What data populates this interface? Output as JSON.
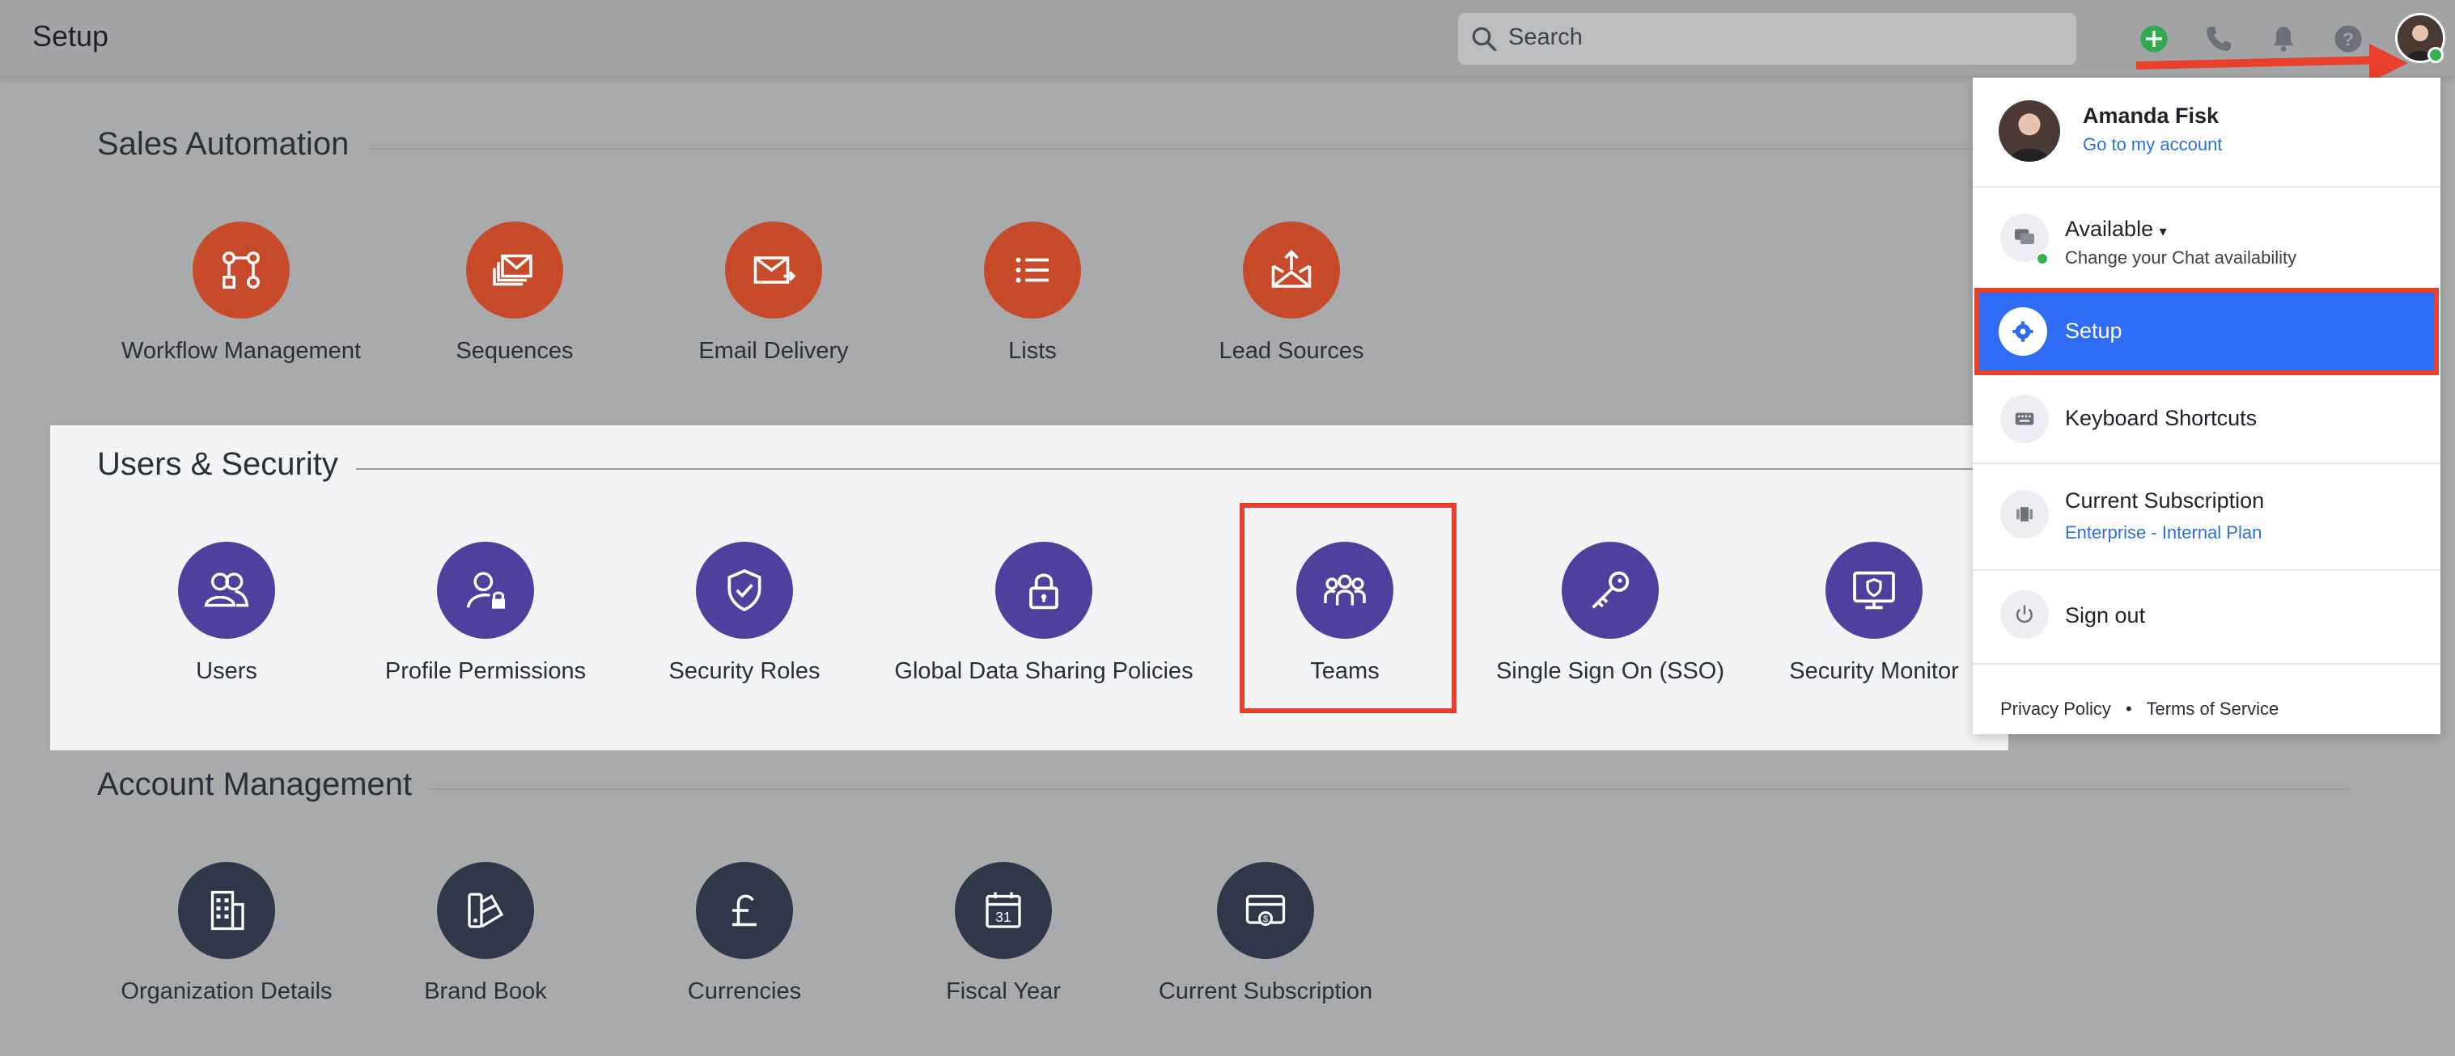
{
  "header": {
    "title": "Setup",
    "search_placeholder": "Search"
  },
  "sections": {
    "sales": {
      "title": "Sales Automation",
      "tiles": [
        {
          "label": "Workflow Management",
          "icon": "workflow-icon"
        },
        {
          "label": "Sequences",
          "icon": "sequences-icon"
        },
        {
          "label": "Email Delivery",
          "icon": "email-icon"
        },
        {
          "label": "Lists",
          "icon": "list-icon"
        },
        {
          "label": "Lead Sources",
          "icon": "lead-sources-icon"
        }
      ]
    },
    "users": {
      "title": "Users & Security",
      "tiles": [
        {
          "label": "Users",
          "icon": "users-icon"
        },
        {
          "label": "Profile Permissions",
          "icon": "profile-lock-icon"
        },
        {
          "label": "Security Roles",
          "icon": "shield-check-icon"
        },
        {
          "label": "Global Data Sharing Policies",
          "icon": "lock-icon"
        },
        {
          "label": "Teams",
          "icon": "teams-icon"
        },
        {
          "label": "Single Sign On (SSO)",
          "icon": "key-icon"
        },
        {
          "label": "Security Monitor",
          "icon": "monitor-shield-icon"
        }
      ]
    },
    "account": {
      "title": "Account Management",
      "tiles": [
        {
          "label": "Organization Details",
          "icon": "building-icon"
        },
        {
          "label": "Brand Book",
          "icon": "brand-book-icon"
        },
        {
          "label": "Currencies",
          "icon": "pound-icon"
        },
        {
          "label": "Fiscal Year",
          "icon": "calendar-icon",
          "badge": "31"
        },
        {
          "label": "Current Subscription",
          "icon": "subscription-icon"
        }
      ]
    }
  },
  "menu": {
    "user_name": "Amanda Fisk",
    "account_link": "Go to my account",
    "availability": "Available",
    "availability_sub": "Change your Chat availability",
    "setup": "Setup",
    "shortcuts": "Keyboard Shortcuts",
    "subscription": "Current Subscription",
    "subscription_plan": "Enterprise - Internal Plan",
    "sign_out": "Sign out",
    "privacy": "Privacy Policy",
    "dot": "•",
    "terms": "Terms of Service"
  },
  "colors": {
    "orange": "#c74b2a",
    "purple": "#50409e",
    "navy": "#2f384b",
    "highlight_red": "#e8402b",
    "setup_blue": "#2e6cf6"
  }
}
